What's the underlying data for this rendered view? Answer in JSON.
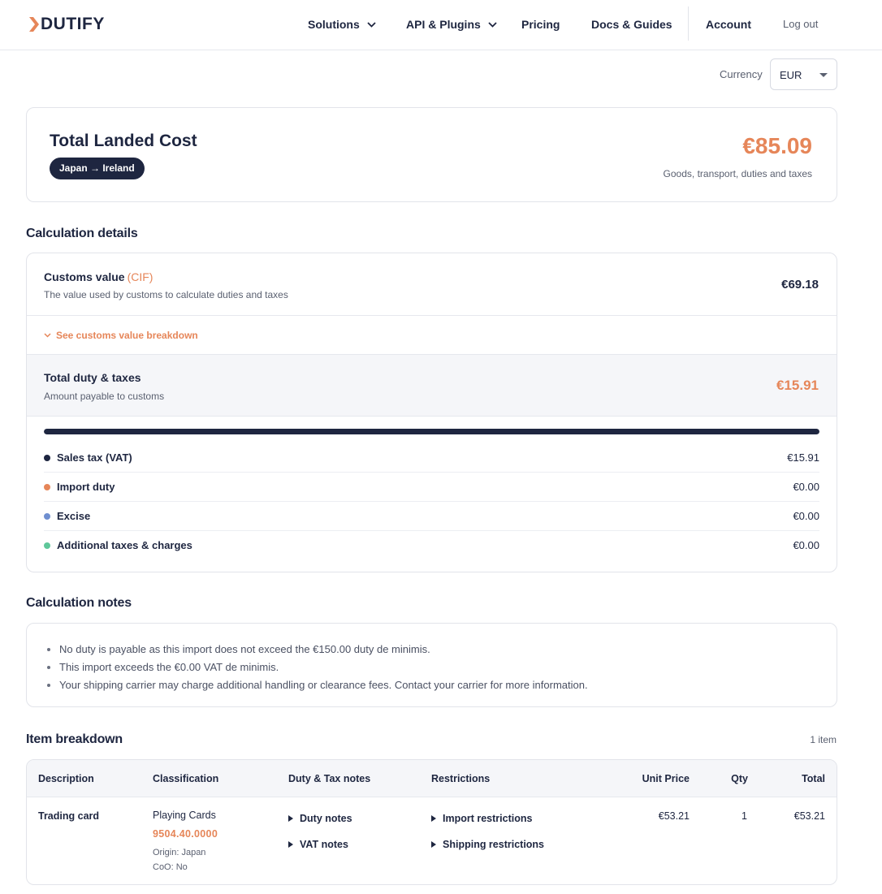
{
  "brand": {
    "name": "DUTIFY",
    "accent": "#e68659",
    "navy": "#1e2640"
  },
  "nav": {
    "solutions": "Solutions",
    "api_plugins": "API & Plugins",
    "pricing": "Pricing",
    "docs": "Docs & Guides",
    "account": "Account",
    "logout": "Log out"
  },
  "currency": {
    "label": "Currency",
    "selected": "EUR"
  },
  "summary": {
    "title": "Total Landed Cost",
    "route": "Japan → Ireland",
    "amount": "€85.09",
    "subtitle": "Goods, transport, duties and taxes"
  },
  "details": {
    "section_title": "Calculation details",
    "customs_value": {
      "label": "Customs value",
      "tag": "(CIF)",
      "description": "The value used by customs to calculate duties and taxes",
      "amount": "€69.18"
    },
    "breakdown_link": "See customs value breakdown",
    "total": {
      "label": "Total duty & taxes",
      "description": "Amount payable to customs",
      "amount": "€15.91"
    },
    "vat_share": 1.0,
    "rows": [
      {
        "label": "Sales tax (VAT)",
        "amount": "€15.91",
        "color": "#1e2640"
      },
      {
        "label": "Import duty",
        "amount": "€0.00",
        "color": "#e68659"
      },
      {
        "label": "Excise",
        "amount": "€0.00",
        "color": "#6f8fd0"
      },
      {
        "label": "Additional taxes & charges",
        "amount": "€0.00",
        "color": "#5fc79a"
      }
    ]
  },
  "notes": {
    "section_title": "Calculation notes",
    "items": [
      "No duty is payable as this import does not exceed the €150.00 duty de minimis.",
      "This import exceeds the €0.00 VAT de minimis.",
      "Your shipping carrier may charge additional handling or clearance fees. Contact your carrier for more information."
    ]
  },
  "items": {
    "section_title": "Item breakdown",
    "count": "1 item",
    "headers": {
      "description": "Description",
      "classification": "Classification",
      "notes": "Duty & Tax notes",
      "restrictions": "Restrictions",
      "unit_price": "Unit Price",
      "qty": "Qty",
      "total": "Total"
    },
    "rows": [
      {
        "description": "Trading card",
        "classification": "Playing Cards",
        "hs_code": "9504.40.0000",
        "origin": "Origin: Japan",
        "coo": "CoO: No",
        "duty_notes": "Duty notes",
        "vat_notes": "VAT notes",
        "import_restrictions": "Import restrictions",
        "shipping_restrictions": "Shipping restrictions",
        "unit_price": "€53.21",
        "qty": "1",
        "total": "€53.21"
      }
    ]
  }
}
